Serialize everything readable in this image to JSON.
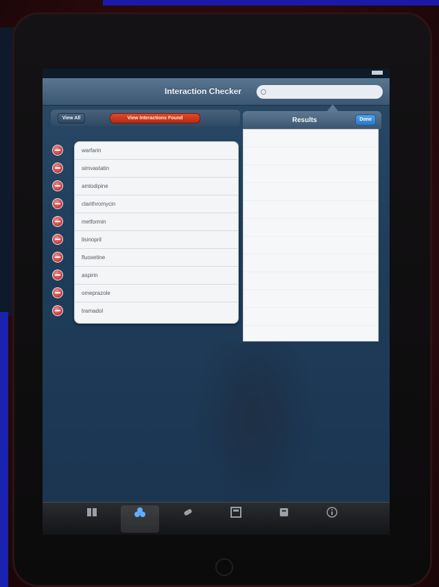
{
  "status_bar": {
    "carrier": "",
    "time": "",
    "battery": ""
  },
  "nav": {
    "title": "Interaction Checker",
    "search_placeholder": ""
  },
  "toolbar": {
    "view_all_label": "View All",
    "view_interactions_label": "View Interactions Found"
  },
  "drugs": [
    "warfarin",
    "simvastatin",
    "amlodipine",
    "clarithromycin",
    "metformin",
    "lisinopril",
    "fluoxetine",
    "aspirin",
    "omeprazole",
    "tramadol"
  ],
  "results": {
    "title": "Results",
    "done_label": "Done"
  },
  "tabs": [
    {
      "label": "",
      "icon": "book-icon"
    },
    {
      "label": "",
      "icon": "interactions-icon",
      "active": true
    },
    {
      "label": "",
      "icon": "pill-icon"
    },
    {
      "label": "",
      "icon": "calculator-icon"
    },
    {
      "label": "",
      "icon": "news-icon"
    },
    {
      "label": "",
      "icon": "info-icon"
    }
  ],
  "colors": {
    "nav_bar": "#4a6682",
    "accent_red": "#c8361c",
    "done_blue": "#3a8ad8",
    "screen_bg": "#1f3d5a"
  }
}
